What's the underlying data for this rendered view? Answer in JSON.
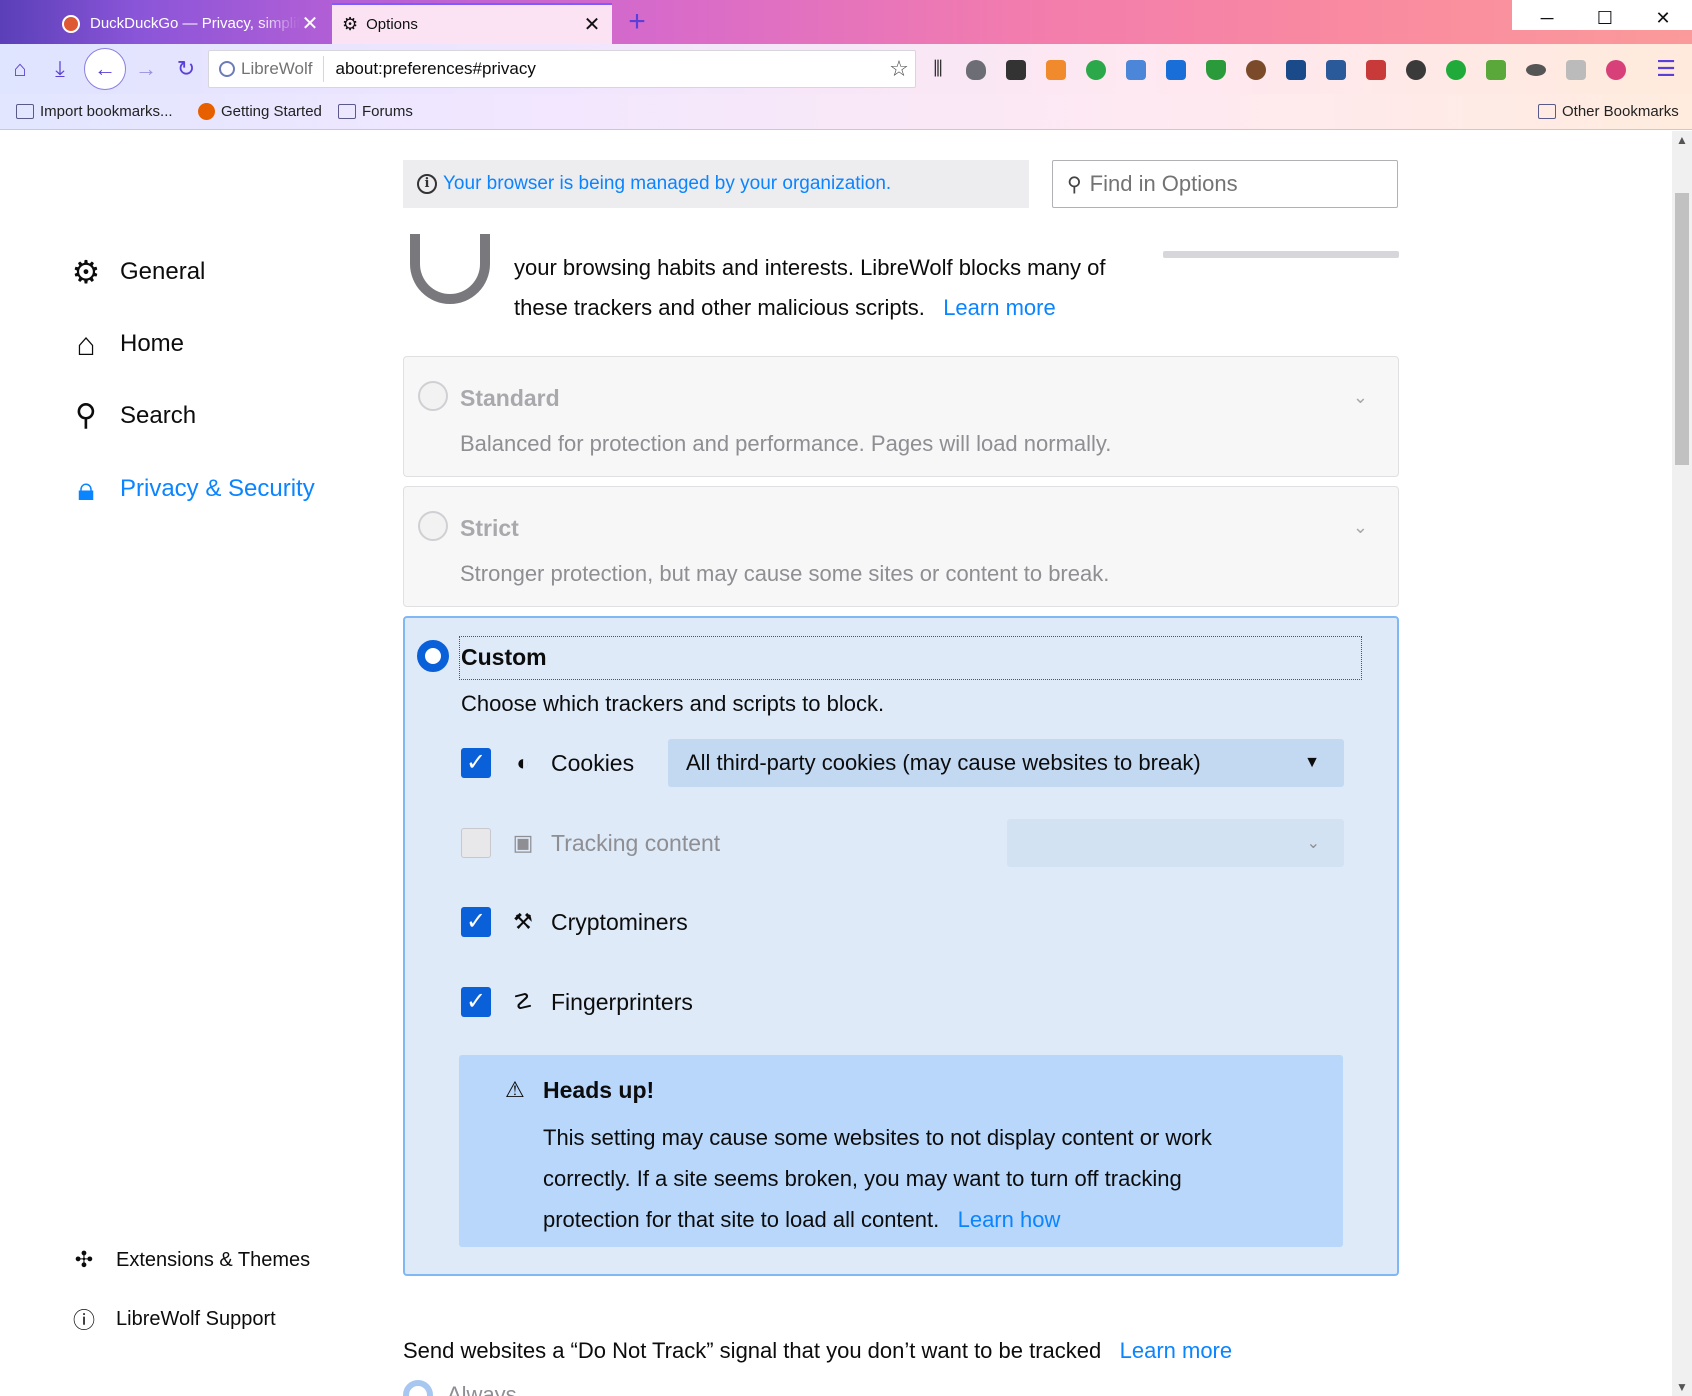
{
  "tabs": [
    {
      "label": "DuckDuckGo — Privacy, simplified.",
      "active": false
    },
    {
      "label": "Options",
      "active": true
    }
  ],
  "window_controls": {
    "minimize": "─",
    "maximize": "☐",
    "close": "✕"
  },
  "toolbar": {
    "identity": "LibreWolf",
    "url": "about:preferences#privacy"
  },
  "bookmarks": {
    "import": "Import bookmarks...",
    "getting_started": "Getting Started",
    "forums": "Forums",
    "other": "Other Bookmarks"
  },
  "sidebar": {
    "items": [
      {
        "label": "General",
        "icon": "gear-icon"
      },
      {
        "label": "Home",
        "icon": "home-icon"
      },
      {
        "label": "Search",
        "icon": "search-icon"
      },
      {
        "label": "Privacy & Security",
        "icon": "lock-icon",
        "active": true
      }
    ],
    "footer": [
      {
        "label": "Extensions & Themes",
        "icon": "puzzle-icon"
      },
      {
        "label": "LibreWolf Support",
        "icon": "help-icon"
      }
    ]
  },
  "managed_notice": "Your browser is being managed by your organization.",
  "search": {
    "placeholder": "Find in Options"
  },
  "intro": {
    "text": "your browsing habits and interests. LibreWolf blocks many of these trackers and other malicious scripts.",
    "link": "Learn more"
  },
  "protection": {
    "standard": {
      "title": "Standard",
      "desc": "Balanced for protection and performance. Pages will load normally."
    },
    "strict": {
      "title": "Strict",
      "desc": "Stronger protection, but may cause some sites or content to break."
    },
    "custom": {
      "title": "Custom",
      "desc": "Choose which trackers and scripts to block."
    }
  },
  "custom_options": {
    "cookies": {
      "label": "Cookies",
      "checked": true,
      "select_value": "All third-party cookies (may cause websites to break)"
    },
    "tracking": {
      "label": "Tracking content",
      "checked": false,
      "select_value": ""
    },
    "cryptominers": {
      "label": "Cryptominers",
      "checked": true
    },
    "fingerprinters": {
      "label": "Fingerprinters",
      "checked": true
    }
  },
  "heads_up": {
    "title": "Heads up!",
    "body": "This setting may cause some websites to not display content or work correctly. If a site seems broken, you may want to turn off tracking protection for that site to load all content.",
    "link": "Learn how"
  },
  "dnt": {
    "text": "Send websites a “Do Not Track” signal that you don’t want to be tracked",
    "link": "Learn more",
    "option_always": "Always"
  },
  "colors": {
    "accent": "#0a84ff",
    "checkbox": "#0a60d8",
    "custom_bg": "#deeaf8"
  }
}
